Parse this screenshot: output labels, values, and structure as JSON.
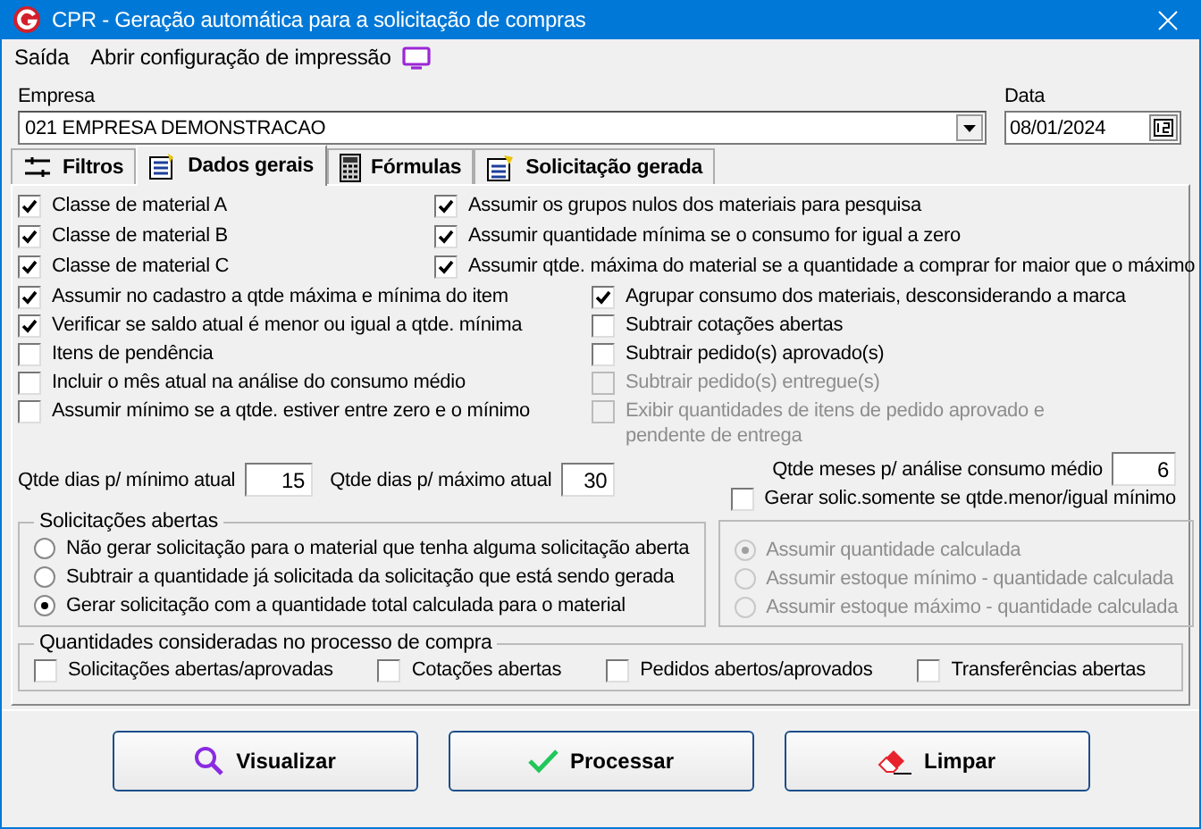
{
  "window": {
    "title": "CPR - Geração automática para a solicitação de compras"
  },
  "menu": [
    {
      "label": "Saída"
    },
    {
      "label": "Abrir configuração de impressão"
    }
  ],
  "empresa": {
    "label": "Empresa",
    "value": "021 EMPRESA DEMONSTRACAO"
  },
  "data": {
    "label": "Data",
    "value": "08/01/2024"
  },
  "tabs": [
    {
      "label": "Filtros",
      "selected": false
    },
    {
      "label": "Dados gerais",
      "selected": true
    },
    {
      "label": "Fórmulas",
      "selected": false
    },
    {
      "label": "Solicitação gerada",
      "selected": false
    }
  ],
  "options_top": [
    {
      "label": "Classe de material A",
      "checked": true,
      "disabled": false
    },
    {
      "label": "Assumir os grupos nulos dos materiais para pesquisa",
      "checked": true,
      "disabled": false
    },
    {
      "label": "Classe de material B",
      "checked": true,
      "disabled": false
    },
    {
      "label": "Assumir quantidade mínima se o consumo for igual a zero",
      "checked": true,
      "disabled": false
    },
    {
      "label": "Classe de material C",
      "checked": true,
      "disabled": false
    },
    {
      "label": "Assumir qtde. máxima do material se a quantidade a comprar for maior que o máximo",
      "checked": true,
      "disabled": false
    }
  ],
  "options_middle": [
    {
      "label": "Assumir no cadastro a qtde máxima e mínima do item",
      "checked": true,
      "disabled": false
    },
    {
      "label": "Agrupar consumo dos materiais, desconsiderando a marca",
      "checked": true,
      "disabled": false
    },
    {
      "label": "Verificar se saldo atual é menor ou igual a qtde. mínima",
      "checked": true,
      "disabled": false
    },
    {
      "label": "Subtrair cotações abertas",
      "checked": false,
      "disabled": false
    },
    {
      "label": "Itens de pendência",
      "checked": false,
      "disabled": false
    },
    {
      "label": "Subtrair pedido(s) aprovado(s)",
      "checked": false,
      "disabled": false
    },
    {
      "label": "Incluir o mês atual na análise do consumo médio",
      "checked": false,
      "disabled": false
    },
    {
      "label": "Subtrair pedido(s) entregue(s)",
      "checked": false,
      "disabled": true
    },
    {
      "label": "Assumir mínimo se a qtde. estiver entre zero e o mínimo",
      "checked": false,
      "disabled": false
    },
    {
      "label": "Exibir quantidades de itens de pedido aprovado e\npendente de entrega",
      "checked": false,
      "disabled": true
    }
  ],
  "dias_minimo": {
    "label": "Qtde dias p/ mínimo atual",
    "value": "15"
  },
  "dias_maximo": {
    "label": "Qtde dias p/ máximo atual",
    "value": "30"
  },
  "meses_consumo": {
    "label": "Qtde meses p/ análise consumo médio",
    "value": "6"
  },
  "gerar_somente": {
    "label": "Gerar solic.somente se qtde.menor/igual mínimo",
    "checked": false,
    "disabled": false
  },
  "solicitacoes_abertas": {
    "title": "Solicitações abertas",
    "options": [
      {
        "label": "Não gerar solicitação para o material que tenha alguma solicitação aberta",
        "selected": false,
        "disabled": false
      },
      {
        "label": "Subtrair a quantidade já solicitada da solicitação que está sendo gerada",
        "selected": false,
        "disabled": false
      },
      {
        "label": "Gerar solicitação com a quantidade total calculada para o material",
        "selected": true,
        "disabled": false
      }
    ]
  },
  "assumir": {
    "options": [
      {
        "label": "Assumir quantidade calculada",
        "selected": true,
        "disabled": true
      },
      {
        "label": "Assumir estoque mínimo - quantidade calculada",
        "selected": false,
        "disabled": true
      },
      {
        "label": "Assumir estoque máximo - quantidade calculada",
        "selected": false,
        "disabled": true
      }
    ]
  },
  "quantidades": {
    "title": "Quantidades consideradas no processo de compra",
    "options": [
      {
        "label": "Solicitações abertas/aprovadas",
        "checked": false,
        "disabled": false
      },
      {
        "label": "Cotações abertas",
        "checked": false,
        "disabled": false
      },
      {
        "label": "Pedidos abertos/aprovados",
        "checked": false,
        "disabled": false
      },
      {
        "label": "Transferências abertas",
        "checked": false,
        "disabled": false
      }
    ]
  },
  "buttons": [
    {
      "label": "Visualizar"
    },
    {
      "label": "Processar"
    },
    {
      "label": "Limpar"
    }
  ]
}
